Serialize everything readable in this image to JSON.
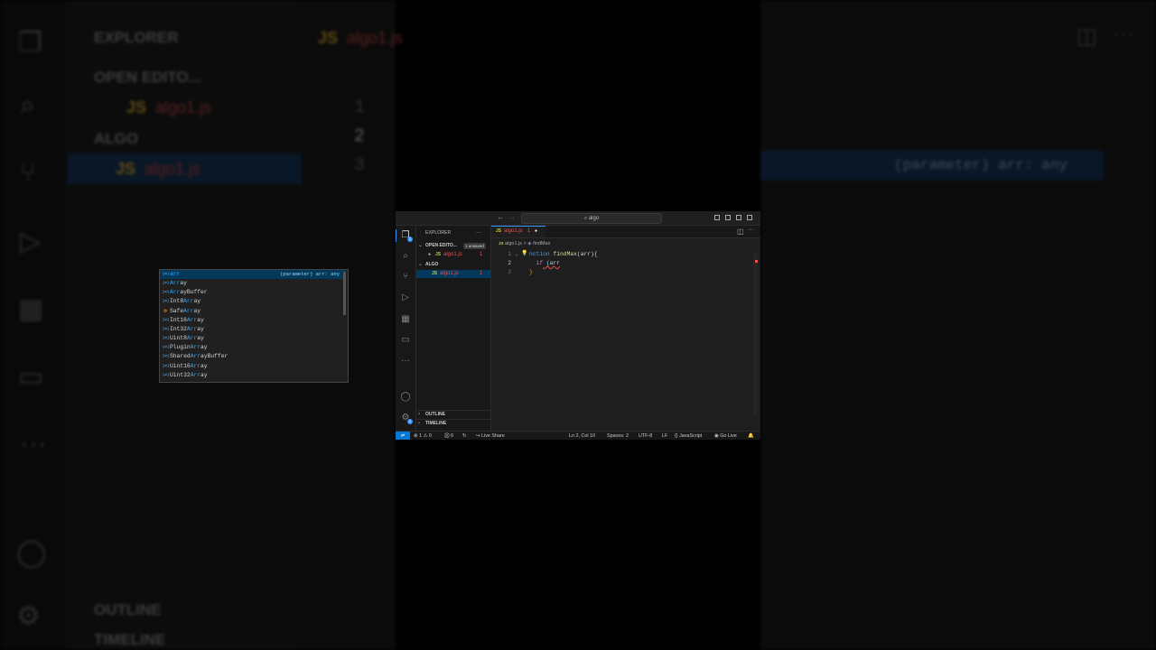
{
  "colors": {
    "accent": "#3794ff",
    "js_yellow": "#cbcb41",
    "error_red": "#f14c4c",
    "selection": "#04395e"
  },
  "titlebar": {
    "back_icon": "arrow-left-icon",
    "forward_icon": "arrow-right-icon",
    "search_text": "algo"
  },
  "explorer": {
    "title": "EXPLORER",
    "more": "···",
    "open_editors_label": "OPEN EDITO...",
    "unsaved_badge": "1 unsaved",
    "open_file": {
      "icon": "JS",
      "name": "algo1.js",
      "count": "1"
    },
    "folder_label": "ALGO",
    "file": {
      "icon": "JS",
      "name": "algo1.js",
      "count": "1"
    },
    "outline_label": "OUTLINE",
    "timeline_label": "TIMELINE"
  },
  "activity_bar": {
    "explorer_badge": "1",
    "settings_badge": "1",
    "more": "···"
  },
  "editor": {
    "tab": {
      "icon": "JS",
      "name": "algo1.js",
      "count": "1"
    },
    "breadcrumb": {
      "file_icon": "JS",
      "file": "algo1.js",
      "separator": ">",
      "symbol": "findMax"
    },
    "lines": [
      {
        "num": "1",
        "pre": "",
        "kw": "nction",
        "fn": " findMax",
        "rest": "(arr){"
      },
      {
        "num": "2",
        "pre": "  ",
        "kw": "if",
        "rest": " (arr"
      },
      {
        "num": "3",
        "brace": "}"
      }
    ]
  },
  "suggestions": {
    "detail": "(parameter) arr: any",
    "items": [
      {
        "match": "arr",
        "rest": "",
        "icon": "[ø]"
      },
      {
        "match": "Arr",
        "rest": "ay",
        "icon": "[ø]"
      },
      {
        "match": "Arr",
        "rest": "ayBuffer",
        "icon": "[ø]"
      },
      {
        "pre": "Int8",
        "match": "Arr",
        "rest": "ay",
        "icon": "[ø]"
      },
      {
        "pre": "Safe",
        "match": "Arr",
        "rest": "ay",
        "icon": "class"
      },
      {
        "pre": "Int16",
        "match": "Arr",
        "rest": "ay",
        "icon": "[ø]"
      },
      {
        "pre": "Int32",
        "match": "Arr",
        "rest": "ay",
        "icon": "[ø]"
      },
      {
        "pre": "Uint8",
        "match": "Arr",
        "rest": "ay",
        "icon": "[ø]"
      },
      {
        "pre": "Plugin",
        "match": "Arr",
        "rest": "ay",
        "icon": "[ø]"
      },
      {
        "pre": "Shared",
        "match": "Arr",
        "rest": "ayBuffer",
        "icon": "[ø]"
      },
      {
        "pre": "Uint16",
        "match": "Arr",
        "rest": "ay",
        "icon": "[ø]"
      },
      {
        "pre": "Uint32",
        "match": "Arr",
        "rest": "ay",
        "icon": "[ø]"
      }
    ]
  },
  "status": {
    "errors": "1",
    "warnings": "0",
    "ports": "0",
    "live_share": "Live Share",
    "position": "Ln 2, Col 10",
    "spaces": "Spaces: 2",
    "encoding": "UTF-8",
    "eol": "LF",
    "language": "JavaScript",
    "go_live": "Go Live"
  }
}
